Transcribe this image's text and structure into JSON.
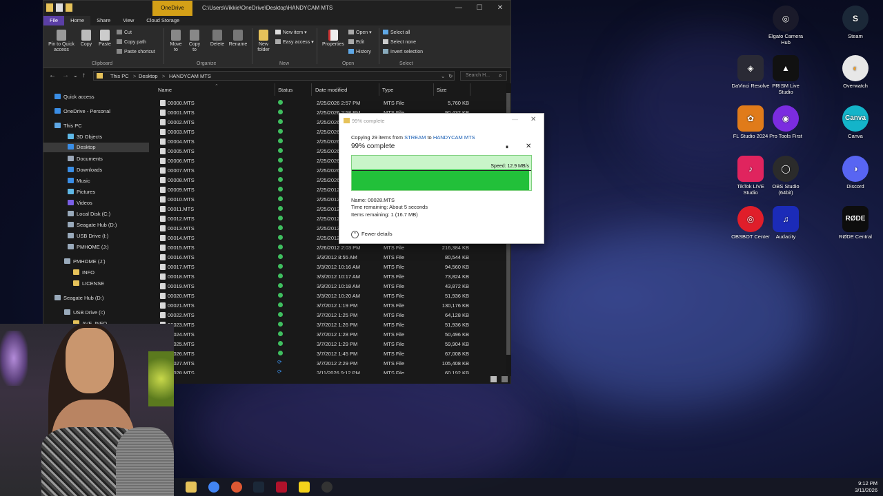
{
  "explorer": {
    "title_path": "C:\\Users\\Vikkie\\OneDrive\\Desktop\\HANDYCAM MTS",
    "context_tab": "OneDrive",
    "window_buttons": {
      "minimize": "—",
      "maximize": "☐",
      "close": "✕"
    },
    "tabs": [
      "File",
      "Home",
      "Share",
      "View",
      "Cloud Storage"
    ],
    "ribbon": {
      "pin": "Pin to Quick access",
      "copy": "Copy",
      "paste": "Paste",
      "cut": "Cut",
      "copy_path": "Copy path",
      "paste_shortcut": "Paste shortcut",
      "move_to": "Move to",
      "copy_to": "Copy to",
      "delete": "Delete",
      "rename": "Rename",
      "new_folder": "New folder",
      "new_item": "New item ▾",
      "easy_access": "Easy access ▾",
      "properties": "Properties",
      "open": "Open ▾",
      "edit": "Edit",
      "history": "History",
      "select_all": "Select all",
      "select_none": "Select none",
      "invert_selection": "Invert selection",
      "groups": {
        "clipboard": "Clipboard",
        "organize": "Organize",
        "new": "New",
        "open": "Open",
        "select": "Select"
      }
    },
    "address": {
      "crumbs": [
        "This PC",
        ">",
        "Desktop",
        ">",
        "HANDYCAM MTS"
      ],
      "search_placeholder": "Search H..."
    },
    "sidebar": [
      {
        "label": "Quick access",
        "icon": "star-icon",
        "color": "#3a8ee6"
      },
      {
        "label": "OneDrive - Personal",
        "icon": "cloud-icon",
        "color": "#3a8ee6"
      },
      {
        "label": "This PC",
        "icon": "computer-icon",
        "color": "#5fa8e6"
      },
      {
        "label": "3D Objects",
        "icon": "cube-icon",
        "color": "#5fb8e6"
      },
      {
        "label": "Desktop",
        "icon": "desktop-icon",
        "color": "#3a8ee6",
        "selected": true
      },
      {
        "label": "Documents",
        "icon": "document-icon",
        "color": "#9aa7b8"
      },
      {
        "label": "Downloads",
        "icon": "download-icon",
        "color": "#3a8ee6"
      },
      {
        "label": "Music",
        "icon": "music-icon",
        "color": "#3a8ee6"
      },
      {
        "label": "Pictures",
        "icon": "picture-icon",
        "color": "#5fb8e6"
      },
      {
        "label": "Videos",
        "icon": "video-icon",
        "color": "#7a5fe6"
      },
      {
        "label": "Local Disk (C:)",
        "icon": "disk-icon",
        "color": "#9ab"
      },
      {
        "label": "Seagate Hub  (D:)",
        "icon": "drive-icon",
        "color": "#9ab"
      },
      {
        "label": "USB Drive (I:)",
        "icon": "usb-icon",
        "color": "#9ab"
      },
      {
        "label": "PMHOME (J:)",
        "icon": "drive-icon",
        "color": "#9ab"
      },
      {
        "label": "PMHOME (J:)",
        "icon": "drive-icon",
        "color": "#9ab"
      },
      {
        "label": "INFO",
        "icon": "folder-icon",
        "color": "#e6c25a"
      },
      {
        "label": "LICENSE",
        "icon": "folder-icon",
        "color": "#e6c25a"
      },
      {
        "label": "Seagate Hub  (D:)",
        "icon": "drive-icon",
        "color": "#9ab"
      },
      {
        "label": "USB Drive (I:)",
        "icon": "usb-icon",
        "color": "#9ab"
      },
      {
        "label": "AVF_INFO",
        "icon": "folder-icon",
        "color": "#e6c25a"
      }
    ],
    "columns": {
      "name": "Name",
      "status": "Status",
      "date": "Date modified",
      "type": "Type",
      "size": "Size"
    },
    "files": [
      {
        "name": "00000.MTS",
        "date": "2/25/2026 2:57 PM",
        "type": "MTS File",
        "size": "5,760 KB",
        "sync": false
      },
      {
        "name": "00001.MTS",
        "date": "2/25/2026 2:58 PM",
        "type": "MTS File",
        "size": "90,432 KB",
        "sync": false
      },
      {
        "name": "00002.MTS",
        "date": "2/25/2026",
        "type": "",
        "size": "",
        "sync": false
      },
      {
        "name": "00003.MTS",
        "date": "2/25/2026",
        "type": "",
        "size": "",
        "sync": false
      },
      {
        "name": "00004.MTS",
        "date": "2/25/2026",
        "type": "",
        "size": "",
        "sync": false
      },
      {
        "name": "00005.MTS",
        "date": "2/25/2026",
        "type": "",
        "size": "",
        "sync": false
      },
      {
        "name": "00006.MTS",
        "date": "2/25/2026",
        "type": "",
        "size": "",
        "sync": false
      },
      {
        "name": "00007.MTS",
        "date": "2/25/2026",
        "type": "",
        "size": "",
        "sync": false
      },
      {
        "name": "00008.MTS",
        "date": "2/25/2026",
        "type": "",
        "size": "",
        "sync": false
      },
      {
        "name": "00009.MTS",
        "date": "2/25/2012",
        "type": "",
        "size": "",
        "sync": false
      },
      {
        "name": "00010.MTS",
        "date": "2/25/2012",
        "type": "",
        "size": "",
        "sync": false
      },
      {
        "name": "00011.MTS",
        "date": "2/25/2012",
        "type": "",
        "size": "",
        "sync": false
      },
      {
        "name": "00012.MTS",
        "date": "2/25/2012",
        "type": "",
        "size": "",
        "sync": false
      },
      {
        "name": "00013.MTS",
        "date": "2/25/2012",
        "type": "",
        "size": "",
        "sync": false
      },
      {
        "name": "00014.MTS",
        "date": "2/25/2012",
        "type": "",
        "size": "",
        "sync": false
      },
      {
        "name": "00015.MTS",
        "date": "2/26/2012 2:03 PM",
        "type": "MTS File",
        "size": "216,384 KB",
        "sync": false
      },
      {
        "name": "00016.MTS",
        "date": "3/3/2012 8:55 AM",
        "type": "MTS File",
        "size": "80,544 KB",
        "sync": false
      },
      {
        "name": "00017.MTS",
        "date": "3/3/2012 10:16 AM",
        "type": "MTS File",
        "size": "94,560 KB",
        "sync": false
      },
      {
        "name": "00018.MTS",
        "date": "3/3/2012 10:17 AM",
        "type": "MTS File",
        "size": "73,824 KB",
        "sync": false
      },
      {
        "name": "00019.MTS",
        "date": "3/3/2012 10:18 AM",
        "type": "MTS File",
        "size": "43,872 KB",
        "sync": false
      },
      {
        "name": "00020.MTS",
        "date": "3/3/2012 10:20 AM",
        "type": "MTS File",
        "size": "51,936 KB",
        "sync": false
      },
      {
        "name": "00021.MTS",
        "date": "3/7/2012 1:19 PM",
        "type": "MTS File",
        "size": "130,176 KB",
        "sync": false
      },
      {
        "name": "00022.MTS",
        "date": "3/7/2012 1:25 PM",
        "type": "MTS File",
        "size": "64,128 KB",
        "sync": false
      },
      {
        "name": "00023.MTS",
        "date": "3/7/2012 1:26 PM",
        "type": "MTS File",
        "size": "51,936 KB",
        "sync": false
      },
      {
        "name": "00024.MTS",
        "date": "3/7/2012 1:28 PM",
        "type": "MTS File",
        "size": "50,496 KB",
        "sync": false
      },
      {
        "name": "00025.MTS",
        "date": "3/7/2012 1:29 PM",
        "type": "MTS File",
        "size": "59,904 KB",
        "sync": false
      },
      {
        "name": "00026.MTS",
        "date": "3/7/2012 1:45 PM",
        "type": "MTS File",
        "size": "67,008 KB",
        "sync": false
      },
      {
        "name": "00027.MTS",
        "date": "3/7/2012 2:29 PM",
        "type": "MTS File",
        "size": "105,408 KB",
        "sync": true
      },
      {
        "name": "00028.MTS",
        "date": "3/11/2026 9:12 PM",
        "type": "MTS File",
        "size": "60,192 KB",
        "sync": true
      }
    ]
  },
  "copy_dialog": {
    "title": "99% complete",
    "copying_prefix": "Copying 29 items from ",
    "source": "STREAM",
    "to": " to ",
    "destination": "HANDYCAM MTS",
    "heading": "99% complete",
    "progress": 0.99,
    "speed": "Speed: 12.9 MB/s",
    "name": "Name:  00028.MTS",
    "time_remaining": "Time remaining:  About 5 seconds",
    "items_remaining": "Items remaining:  1 (16.7 MB)",
    "fewer_details": "Fewer details",
    "pause": "⏸",
    "stop": "✕",
    "close": "✕",
    "minimize": "—"
  },
  "desktop_icons": [
    {
      "label": "Elgato Camera Hub",
      "icon": "elgato-icon",
      "color": "#1a1a2a",
      "glyph": "◎"
    },
    {
      "label": "Steam",
      "icon": "steam-icon",
      "color": "#1b2838",
      "glyph": "S"
    },
    {
      "label": "DaVinci Resolve",
      "icon": "davinci-icon",
      "color": "#2a2a35",
      "glyph": "◈"
    },
    {
      "label": "PRISM Live Studio",
      "icon": "prism-icon",
      "color": "#111",
      "glyph": "▲"
    },
    {
      "label": "Overwatch",
      "icon": "overwatch-icon",
      "color": "#e8e8e8",
      "glyph": "◐"
    },
    {
      "label": "FL Studio 2024",
      "icon": "flstudio-icon",
      "color": "#e07b1a",
      "glyph": "✿"
    },
    {
      "label": "Pro Tools First",
      "icon": "protools-icon",
      "color": "#7b2ce0",
      "glyph": "◉"
    },
    {
      "label": "Canva",
      "icon": "canva-icon",
      "color": "#14b4c9",
      "glyph": "Canva"
    },
    {
      "label": "TikTok LIVE Studio",
      "icon": "tiktok-icon",
      "color": "#e0245e",
      "glyph": "♪"
    },
    {
      "label": "OBS Studio (64bit)",
      "icon": "obs-icon",
      "color": "#2b2b2b",
      "glyph": "◯"
    },
    {
      "label": "Discord",
      "icon": "discord-icon",
      "color": "#5865f2",
      "glyph": "◑"
    },
    {
      "label": "OBSBOT Center",
      "icon": "obsbot-icon",
      "color": "#e01e2a",
      "glyph": "◎"
    },
    {
      "label": "Audacity",
      "icon": "audacity-icon",
      "color": "#1b2bb8",
      "glyph": "♫"
    },
    {
      "label": "RØDE Central",
      "icon": "rode-icon",
      "color": "#0d0d0d",
      "glyph": "RØDE"
    }
  ],
  "taskbar": {
    "apps": [
      {
        "icon": "file-explorer-icon",
        "color": "#e6c25a"
      },
      {
        "icon": "chrome-icon",
        "color": "#4285f4"
      },
      {
        "icon": "duckduckgo-icon",
        "color": "#de5833"
      },
      {
        "icon": "steam-icon",
        "color": "#1b2838"
      },
      {
        "icon": "voicemod-icon",
        "color": "#b0122b"
      },
      {
        "icon": "sticky-notes-icon",
        "color": "#f4d21b"
      },
      {
        "icon": "obs-icon",
        "color": "#333"
      }
    ],
    "time": "9:12 PM",
    "date": "3/11/2026"
  }
}
